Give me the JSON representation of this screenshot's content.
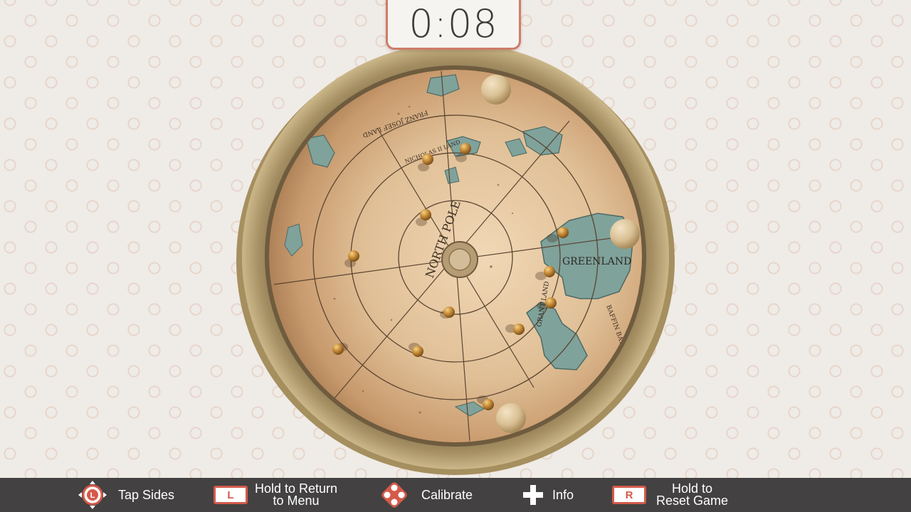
{
  "timer": {
    "value": "0:08"
  },
  "map": {
    "center_label": "NORTH POLE",
    "land_labels": [
      "GREENLAND",
      "FRANZ JOSEF LAND",
      "NICHOLAS II LAND",
      "GRANT LAND",
      "BAFFIN BAY"
    ]
  },
  "controls": {
    "tap_sides": "Tap Sides",
    "return_line1": "Hold to Return",
    "return_line2": "to Menu",
    "return_key": "L",
    "calibrate": "Calibrate",
    "info": "Info",
    "reset_line1": "Hold to",
    "reset_line2": "Reset Game",
    "reset_key": "R"
  },
  "colors": {
    "footer_bg": "#434141",
    "accent": "#d45a4a",
    "rim": "#b59e6c",
    "parchment": "#d9b48a",
    "water_land": "#7fa29b",
    "ball": "#c0893a"
  },
  "icons": [
    "l-stick-icon",
    "l-button-icon",
    "dpad-icon",
    "plus-icon",
    "r-button-icon"
  ]
}
